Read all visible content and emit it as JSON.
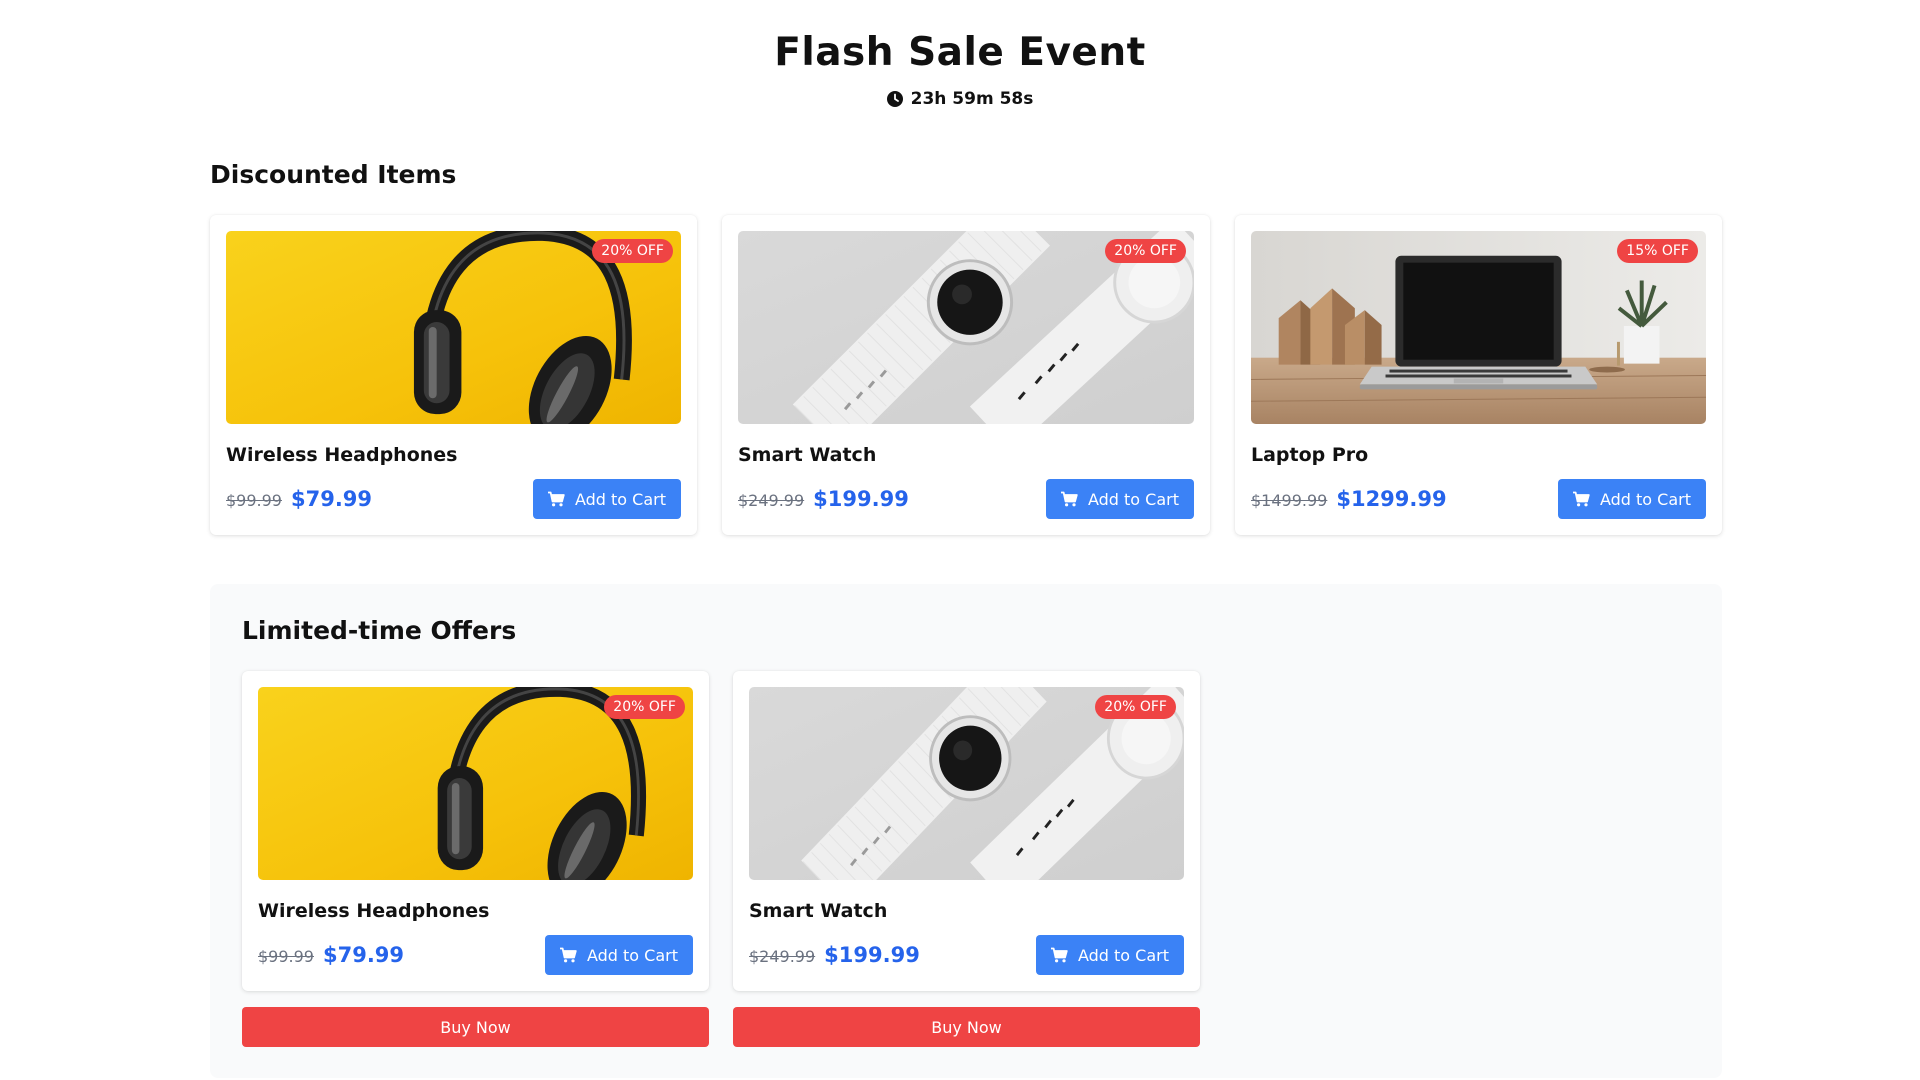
{
  "header": {
    "title": "Flash Sale Event",
    "countdown": "23h 59m 58s"
  },
  "discounted": {
    "title": "Discounted Items",
    "items": [
      {
        "name": "Wireless Headphones",
        "old_price": "$99.99",
        "new_price": "$79.99",
        "badge": "20% OFF",
        "button": "Add to Cart",
        "image": "headphones"
      },
      {
        "name": "Smart Watch",
        "old_price": "$249.99",
        "new_price": "$199.99",
        "badge": "20% OFF",
        "button": "Add to Cart",
        "image": "smartwatch"
      },
      {
        "name": "Laptop Pro",
        "old_price": "$1499.99",
        "new_price": "$1299.99",
        "badge": "15% OFF",
        "button": "Add to Cart",
        "image": "laptop"
      }
    ]
  },
  "offers": {
    "title": "Limited-time Offers",
    "items": [
      {
        "name": "Wireless Headphones",
        "old_price": "$99.99",
        "new_price": "$79.99",
        "badge": "20% OFF",
        "button": "Add to Cart",
        "buy_button": "Buy Now",
        "image": "headphones"
      },
      {
        "name": "Smart Watch",
        "old_price": "$249.99",
        "new_price": "$199.99",
        "badge": "20% OFF",
        "button": "Add to Cart",
        "buy_button": "Buy Now",
        "image": "smartwatch"
      }
    ]
  },
  "colors": {
    "accent_blue": "#3b82f6",
    "price_blue": "#2563eb",
    "badge_red": "#ef4444",
    "panel_bg": "#f9fafb"
  },
  "icons": {
    "timer": "clock-icon",
    "cart": "cart-icon"
  }
}
